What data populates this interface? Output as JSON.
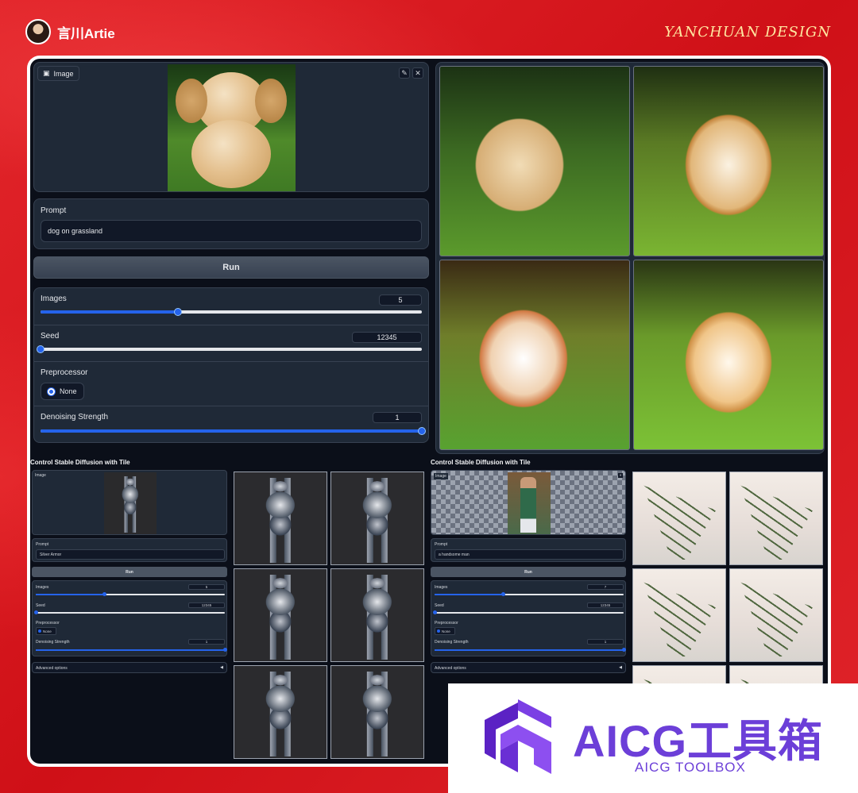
{
  "brand": {
    "name": "言川Artie",
    "design": "YANCHUAN DESIGN"
  },
  "top": {
    "image_panel": {
      "label": "Image",
      "edit_icon": "pencil-icon",
      "close_icon": "close-icon"
    },
    "prompt": {
      "label": "Prompt",
      "value": "dog on grassland"
    },
    "run_label": "Run",
    "images": {
      "label": "Images",
      "value": "5",
      "fraction": 0.36
    },
    "seed": {
      "label": "Seed",
      "value": "12345",
      "fraction": 0.0
    },
    "preprocessor": {
      "label": "Preprocessor",
      "option": "None"
    },
    "denoising": {
      "label": "Denoising Strength",
      "value": "1",
      "fraction": 1.0
    }
  },
  "bottom_left": {
    "title": "Control Stable Diffusion with Tile",
    "image_label": "Image",
    "prompt": {
      "label": "Prompt",
      "value": "Silver Armor"
    },
    "run_label": "Run",
    "images": {
      "label": "Images",
      "value": "5",
      "fraction": 0.36
    },
    "seed": {
      "label": "Seed",
      "value": "12345",
      "fraction": 0.0
    },
    "preprocessor": {
      "label": "Preprocessor",
      "option": "None"
    },
    "denoising": {
      "label": "Denoising Strength",
      "value": "1",
      "fraction": 1.0
    },
    "advanced": "Advanced options"
  },
  "bottom_right": {
    "title": "Control Stable Diffusion with Tile",
    "image_label": "Image",
    "prompt": {
      "label": "Prompt",
      "value": "a handsome man"
    },
    "run_label": "Run",
    "images": {
      "label": "Images",
      "value": "7",
      "fraction": 0.36
    },
    "seed": {
      "label": "Seed",
      "value": "12345",
      "fraction": 0.0
    },
    "preprocessor": {
      "label": "Preprocessor",
      "option": "None"
    },
    "denoising": {
      "label": "Denoising Strength",
      "value": "1",
      "fraction": 1.0
    },
    "advanced": "Advanced options"
  },
  "watermark": {
    "title": "AICG工具箱",
    "subtitle": "AICG TOOLBOX"
  },
  "colors": {
    "accent": "#2563eb",
    "panel": "#1f2937",
    "app_bg": "#0b0f19",
    "brand_purple": "#6c3fd8",
    "background_red": "#d8141b"
  }
}
